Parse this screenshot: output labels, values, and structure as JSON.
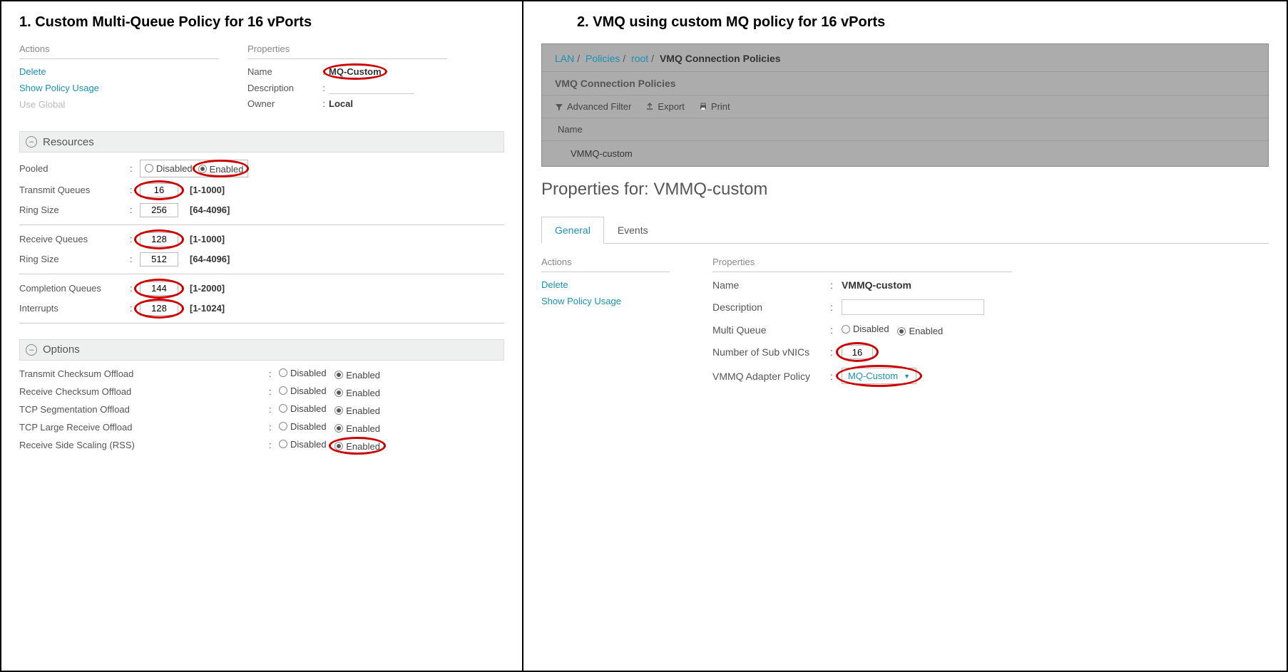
{
  "left": {
    "title": "1. Custom Multi-Queue Policy for 16 vPorts",
    "actions_label": "Actions",
    "actions": {
      "delete": "Delete",
      "show_usage": "Show Policy Usage",
      "use_global": "Use Global"
    },
    "properties_label": "Properties",
    "properties": {
      "name_label": "Name",
      "name_value": "MQ-Custom",
      "desc_label": "Description",
      "desc_value": "",
      "owner_label": "Owner",
      "owner_value": "Local"
    },
    "resources": {
      "header": "Resources",
      "pooled_label": "Pooled",
      "disabled": "Disabled",
      "enabled": "Enabled",
      "tx_queues_label": "Transmit Queues",
      "tx_queues_value": "16",
      "tx_queues_range": "[1-1000]",
      "tx_ring_label": "Ring Size",
      "tx_ring_value": "256",
      "tx_ring_range": "[64-4096]",
      "rx_queues_label": "Receive Queues",
      "rx_queues_value": "128",
      "rx_queues_range": "[1-1000]",
      "rx_ring_label": "Ring Size",
      "rx_ring_value": "512",
      "rx_ring_range": "[64-4096]",
      "cq_label": "Completion Queues",
      "cq_value": "144",
      "cq_range": "[1-2000]",
      "int_label": "Interrupts",
      "int_value": "128",
      "int_range": "[1-1024]"
    },
    "options": {
      "header": "Options",
      "tx_csum": "Transmit Checksum Offload",
      "rx_csum": "Receive Checksum Offload",
      "tcp_seg": "TCP Segmentation Offload",
      "tcp_lro": "TCP Large Receive Offload",
      "rss": "Receive Side Scaling (RSS)",
      "disabled": "Disabled",
      "enabled": "Enabled"
    }
  },
  "right": {
    "title": "2. VMQ using custom MQ policy for 16 vPorts",
    "breadcrumb": {
      "lan": "LAN",
      "policies": "Policies",
      "root": "root",
      "current": "VMQ Connection Policies"
    },
    "gray": {
      "section_title": "VMQ Connection Policies",
      "adv_filter": "Advanced Filter",
      "export": "Export",
      "print": "Print",
      "col_name": "Name",
      "row_value": "VMMQ-custom"
    },
    "props_title": "Properties for: VMMQ-custom",
    "tabs": {
      "general": "General",
      "events": "Events"
    },
    "actions_label": "Actions",
    "actions": {
      "delete": "Delete",
      "show_usage": "Show Policy Usage"
    },
    "properties_label": "Properties",
    "properties": {
      "name_label": "Name",
      "name_value": "VMMQ-custom",
      "desc_label": "Description",
      "desc_value": "",
      "mq_label": "Multi Queue",
      "disabled": "Disabled",
      "enabled": "Enabled",
      "sub_vnics_label": "Number of Sub vNICs",
      "sub_vnics_value": "16",
      "adapter_label": "VMMQ Adapter Policy",
      "adapter_value": "MQ-Custom"
    }
  }
}
